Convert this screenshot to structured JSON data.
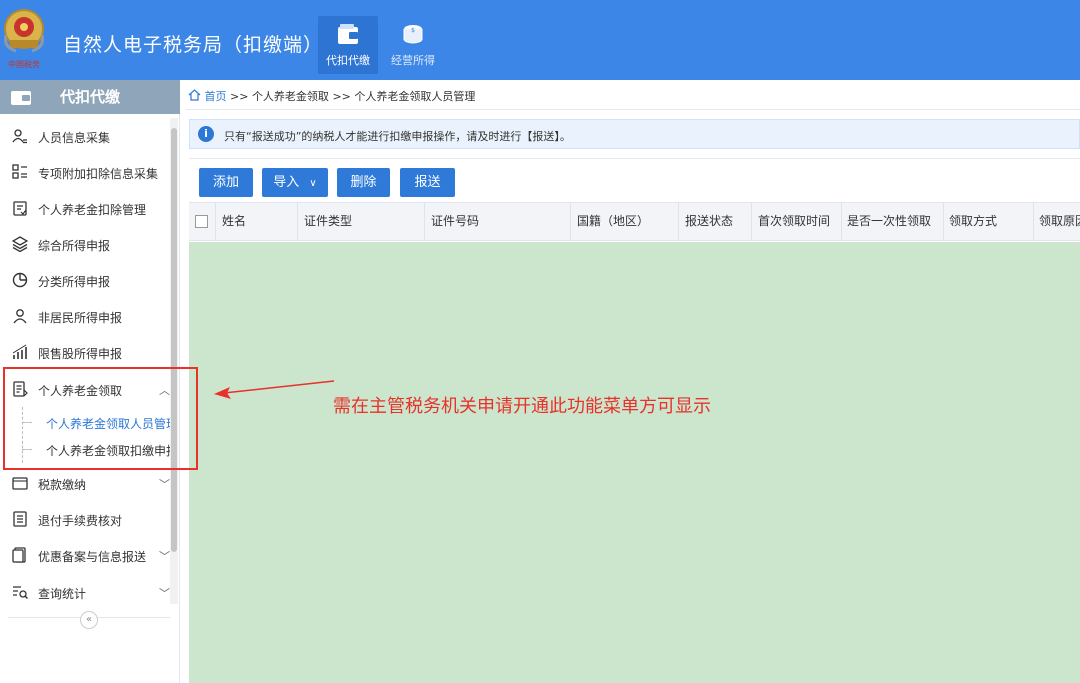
{
  "header": {
    "app_title": "自然人电子税务局（扣缴端）",
    "nav": [
      {
        "label": "代扣代缴",
        "icon": "wallet-icon",
        "active": true
      },
      {
        "label": "经营所得",
        "icon": "coins-icon",
        "active": false
      }
    ],
    "accent_color": "#3b86e6"
  },
  "sidebar": {
    "title": "代扣代缴",
    "items": [
      {
        "label": "人员信息采集",
        "icon": "person-id-icon"
      },
      {
        "label": "专项附加扣除信息采集",
        "icon": "list-grid-icon"
      },
      {
        "label": "个人养老金扣除管理",
        "icon": "clipboard-icon"
      },
      {
        "label": "综合所得申报",
        "icon": "layers-icon"
      },
      {
        "label": "分类所得申报",
        "icon": "clock-pie-icon"
      },
      {
        "label": "非居民所得申报",
        "icon": "person-icon"
      },
      {
        "label": "限售股所得申报",
        "icon": "bar-chart-icon"
      },
      {
        "label": "个人养老金领取",
        "icon": "document-icon",
        "expanded": true
      },
      {
        "label": "税款缴纳",
        "icon": "folder-icon"
      },
      {
        "label": "退付手续费核对",
        "icon": "receipt-icon"
      },
      {
        "label": "优惠备案与信息报送",
        "icon": "page-icon"
      },
      {
        "label": "查询统计",
        "icon": "search-list-icon"
      }
    ],
    "sub_items": [
      {
        "label": "个人养老金领取人员管理",
        "active": true
      },
      {
        "label": "个人养老金领取扣缴申报",
        "active": false
      }
    ]
  },
  "breadcrumb": {
    "home": "首页",
    "sep": ">>",
    "parts": [
      "个人养老金领取",
      "个人养老金领取人员管理"
    ]
  },
  "notice": {
    "text": "只有“报送成功”的纳税人才能进行扣缴申报操作，请及时进行【报送】。"
  },
  "toolbar": {
    "add": "添加",
    "import": "导入",
    "delete": "删除",
    "submit": "报送"
  },
  "table": {
    "columns": [
      "姓名",
      "证件类型",
      "证件号码",
      "国籍（地区）",
      "报送状态",
      "首次领取时间",
      "是否一次性领取",
      "领取方式",
      "领取原因"
    ],
    "rows": []
  },
  "annotation": {
    "text": "需在主管税务机关申请开通此功能菜单方可显示",
    "color": "#e8312b"
  }
}
